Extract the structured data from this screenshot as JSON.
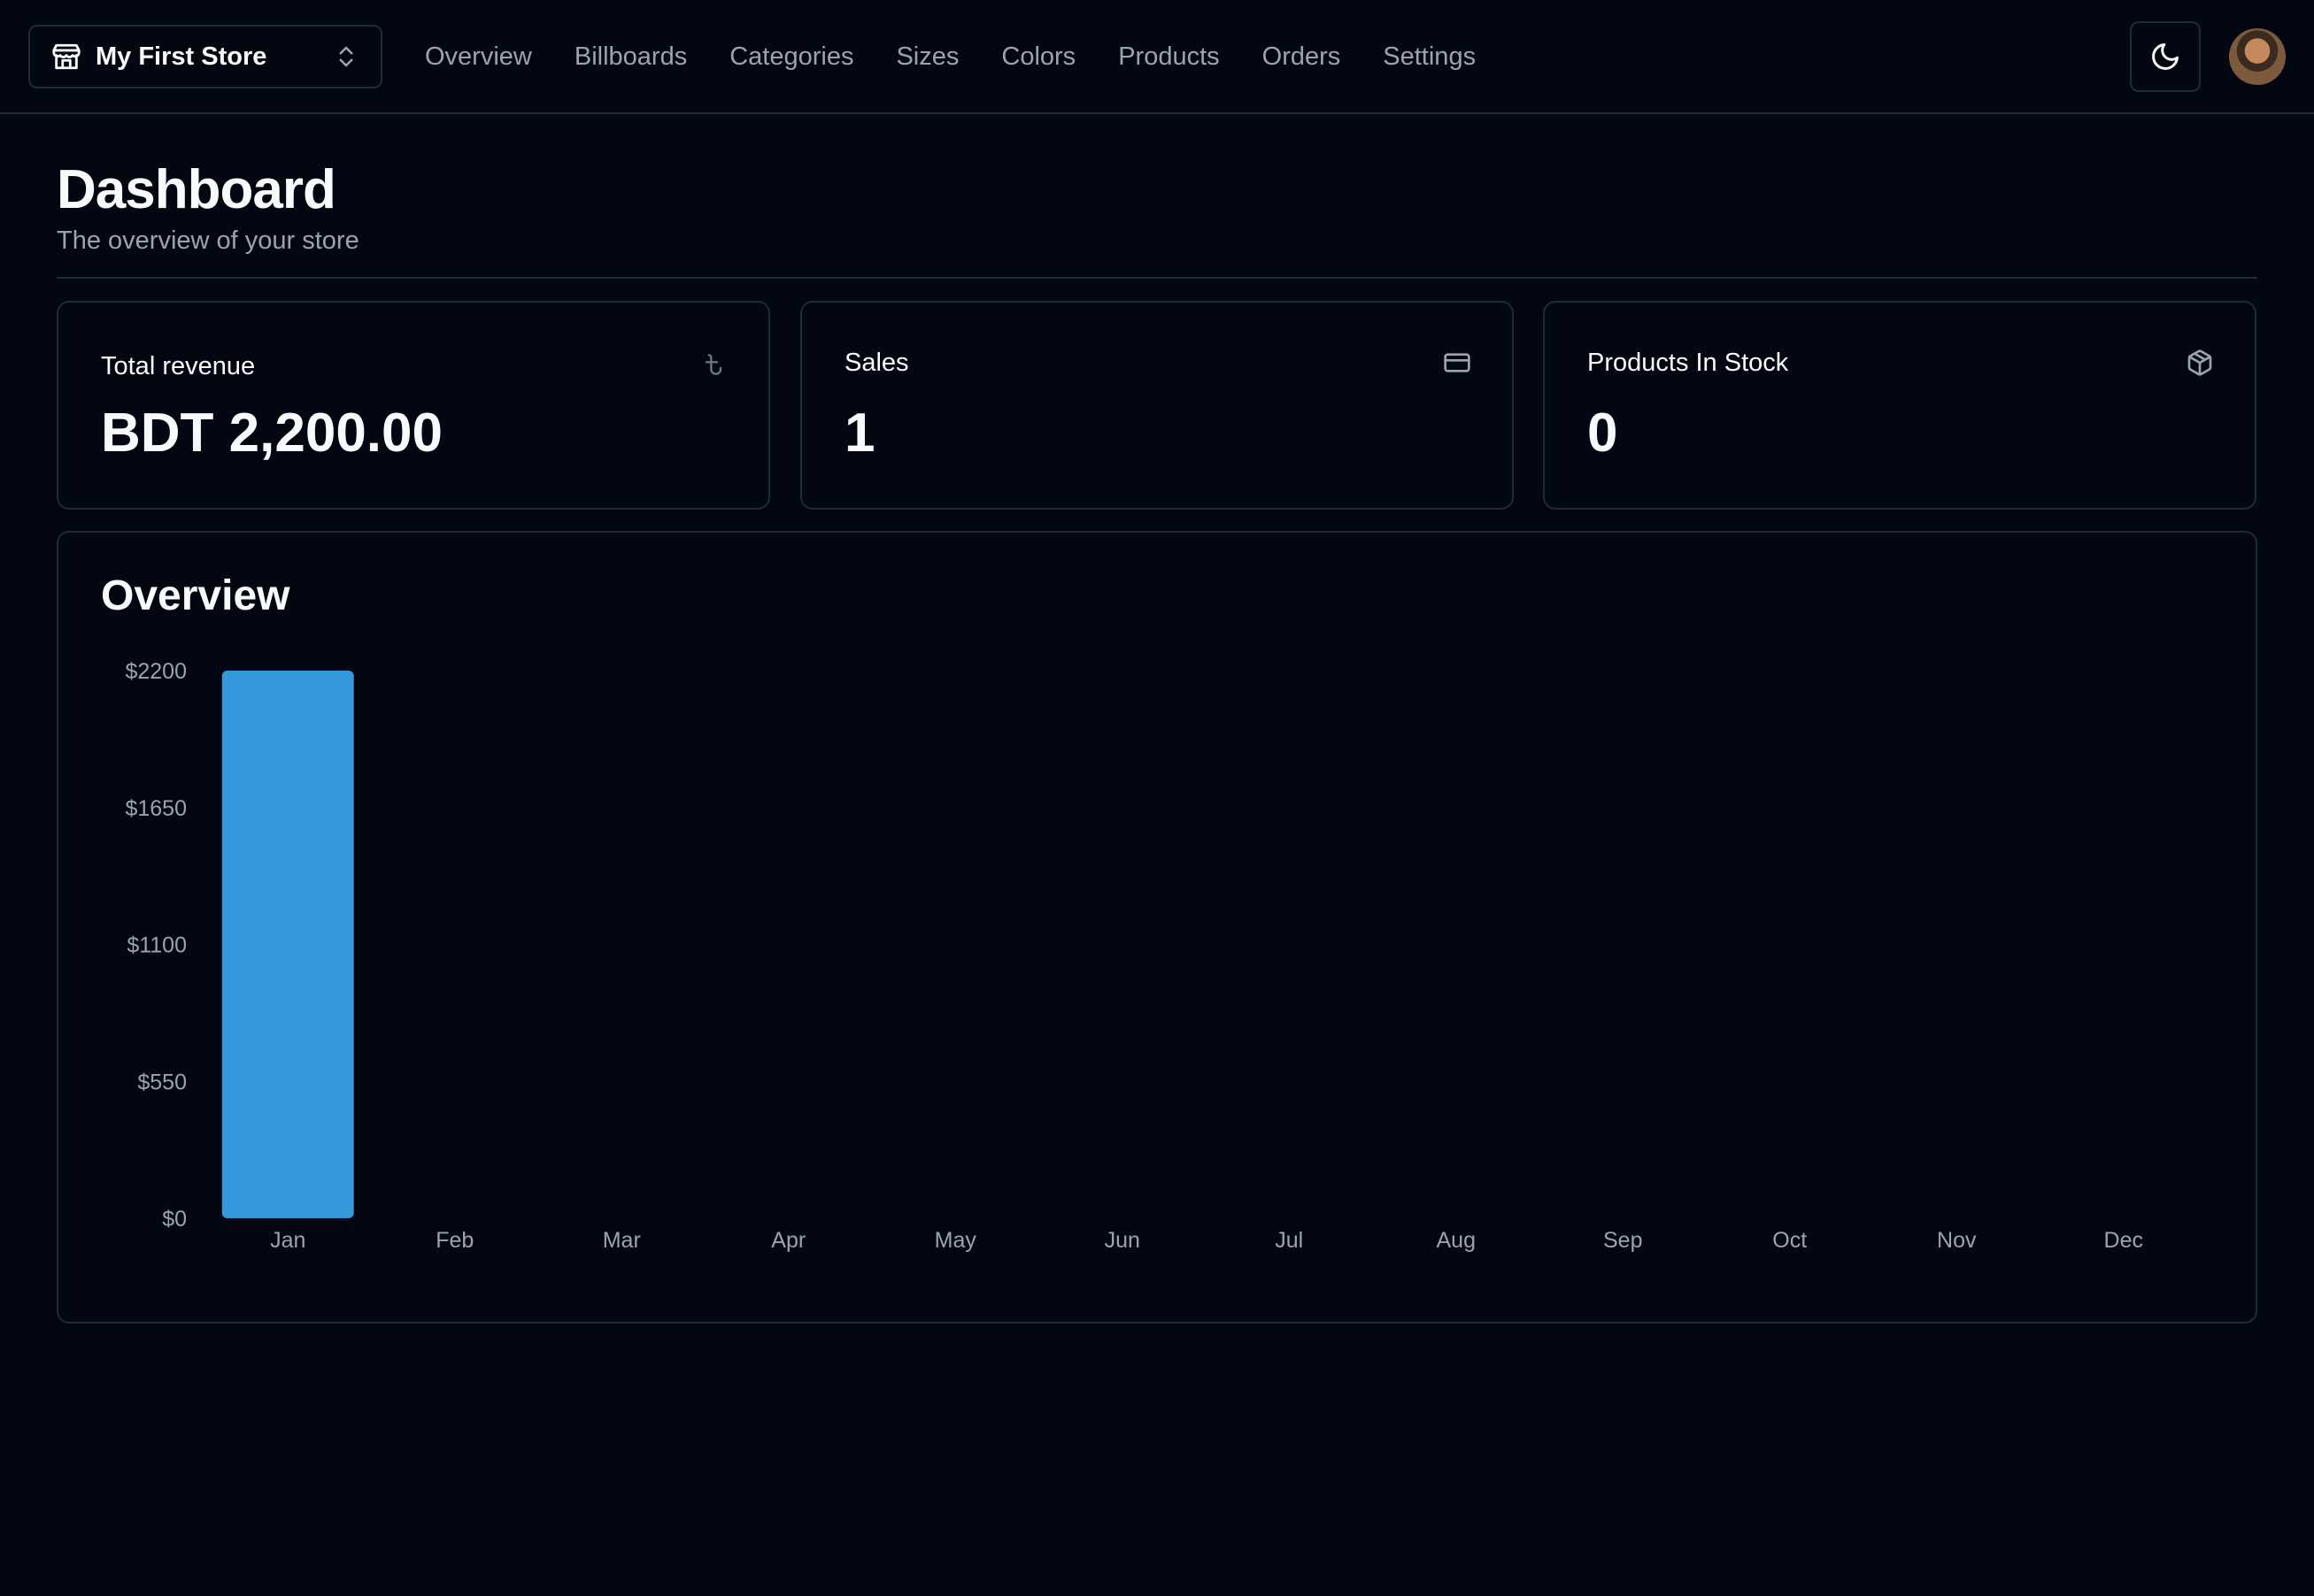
{
  "store_switcher": {
    "name": "My First Store",
    "icon": "store-icon"
  },
  "nav": [
    {
      "label": "Overview"
    },
    {
      "label": "Billboards"
    },
    {
      "label": "Categories"
    },
    {
      "label": "Sizes"
    },
    {
      "label": "Colors"
    },
    {
      "label": "Products"
    },
    {
      "label": "Orders"
    },
    {
      "label": "Settings"
    }
  ],
  "header": {
    "theme_toggle_icon": "moon-icon",
    "avatar_icon": "user-avatar"
  },
  "page": {
    "title": "Dashboard",
    "subtitle": "The overview of your store"
  },
  "stats": [
    {
      "label": "Total revenue",
      "value": "BDT 2,200.00",
      "icon": "taka-icon"
    },
    {
      "label": "Sales",
      "value": "1",
      "icon": "credit-card-icon"
    },
    {
      "label": "Products In Stock",
      "value": "0",
      "icon": "package-icon"
    }
  ],
  "overview": {
    "title": "Overview"
  },
  "colors": {
    "accent": "#3498db",
    "background": "#030712",
    "border": "#1f2937",
    "muted": "#9ca3af"
  },
  "chart_data": {
    "type": "bar",
    "categories": [
      "Jan",
      "Feb",
      "Mar",
      "Apr",
      "May",
      "Jun",
      "Jul",
      "Aug",
      "Sep",
      "Oct",
      "Nov",
      "Dec"
    ],
    "values": [
      2200,
      0,
      0,
      0,
      0,
      0,
      0,
      0,
      0,
      0,
      0,
      0
    ],
    "yticks": [
      "$0",
      "$550",
      "$1100",
      "$1650",
      "$2200"
    ],
    "ylim": [
      0,
      2200
    ],
    "grid": false,
    "title": "",
    "xlabel": "",
    "ylabel": ""
  }
}
